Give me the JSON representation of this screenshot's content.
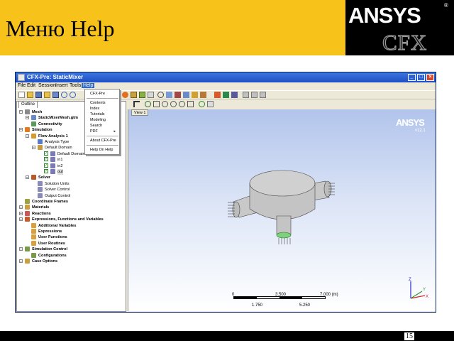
{
  "slide": {
    "title": "Меню Help",
    "page_number": "15",
    "logo": {
      "brand": "ANSYS",
      "product": "CFX",
      "registered": "®"
    },
    "colors": {
      "header": "#f7c31b",
      "logo_bg": "#000000",
      "footer": "#000000"
    }
  },
  "window": {
    "title": "CFX-Pre: StaticMixer",
    "menu": [
      "File",
      "Edit",
      "Session",
      "Insert",
      "Tools",
      "Help"
    ],
    "active_menu": "Help",
    "help_menu": {
      "items": [
        "CFX-Pre",
        "Contents",
        "Index",
        "Tutorials",
        "Modeling",
        "Search",
        "PDF",
        "About CFX-Pre",
        "Help On Help"
      ],
      "submenu_item": "PDF"
    }
  },
  "outline": {
    "tab": "Outline",
    "tree": [
      {
        "label": "Mesh",
        "bold": true,
        "icon": "mesh-icon"
      },
      {
        "label": "StaticMixerMesh.gtm",
        "bold": true,
        "icon": "mesh-file-icon"
      },
      {
        "label": "Connectivity",
        "bold": true,
        "icon": "connectivity-icon"
      },
      {
        "label": "Simulation",
        "bold": true,
        "icon": "simulation-icon"
      },
      {
        "label": "Flow Analysis 1",
        "bold": true,
        "icon": "flow-analysis-icon"
      },
      {
        "label": "Analysis Type",
        "bold": false,
        "icon": "analysis-type-icon"
      },
      {
        "label": "Default Domain",
        "bold": false,
        "icon": "domain-icon"
      },
      {
        "label": "Default Domain Default",
        "bold": false,
        "icon": "boundary-icon"
      },
      {
        "label": "in1",
        "bold": false,
        "icon": "boundary-icon"
      },
      {
        "label": "in2",
        "bold": false,
        "icon": "boundary-icon"
      },
      {
        "label": "out",
        "bold": false,
        "icon": "boundary-icon"
      },
      {
        "label": "Solver",
        "bold": true,
        "icon": "solver-icon"
      },
      {
        "label": "Solution Units",
        "bold": false,
        "icon": "units-icon"
      },
      {
        "label": "Solver Control",
        "bold": false,
        "icon": "solver-control-icon"
      },
      {
        "label": "Output Control",
        "bold": false,
        "icon": "output-control-icon"
      },
      {
        "label": "Coordinate Frames",
        "bold": true,
        "icon": "coordinate-frames-icon"
      },
      {
        "label": "Materials",
        "bold": true,
        "icon": "materials-icon"
      },
      {
        "label": "Reactions",
        "bold": true,
        "icon": "reactions-icon"
      },
      {
        "label": "Expressions, Functions and Variables",
        "bold": true,
        "icon": "expressions-icon"
      },
      {
        "label": "Additional Variables",
        "bold": true,
        "icon": "variables-icon"
      },
      {
        "label": "Expressions",
        "bold": true,
        "icon": "expressions-icon"
      },
      {
        "label": "User Functions",
        "bold": true,
        "icon": "functions-icon"
      },
      {
        "label": "User Routines",
        "bold": true,
        "icon": "routines-icon"
      },
      {
        "label": "Simulation Control",
        "bold": true,
        "icon": "simulation-control-icon"
      },
      {
        "label": "Configurations",
        "bold": true,
        "icon": "configurations-icon"
      },
      {
        "label": "Case Options",
        "bold": true,
        "icon": "case-options-icon"
      }
    ]
  },
  "viewer": {
    "tab": "View 1",
    "logo": "ANSYS",
    "version": "v12.1",
    "scale": {
      "top_labels": [
        "0",
        "3.500",
        "7.000  (m)"
      ],
      "bottom_labels": [
        "1.750",
        "5.250"
      ]
    },
    "axes": {
      "x": "X",
      "y": "Y",
      "z": "Z"
    }
  }
}
